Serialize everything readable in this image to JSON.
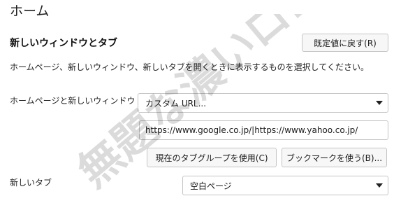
{
  "page": {
    "title": "ホーム"
  },
  "homepage_section": {
    "heading": "新しいウィンドウとタブ",
    "restore_defaults_label": "既定値に戻す(R)",
    "description": "ホームページ、新しいウィンドウ、新しいタブを開くときに表示するものを選択してください。",
    "homepage_label": "ホームページと新しいウィンドウ",
    "homepage_select_value": "カスタム URL...",
    "homepage_url_value": "https://www.google.co.jp/|https://www.yahoo.co.jp/",
    "use_current_pages_label": "現在のタブグループを使用(C)",
    "use_bookmark_label": "ブックマークを使う(B)...",
    "newtab_label": "新しいタブ",
    "newtab_select_value": "空白ページ"
  },
  "watermark": {
    "text": "無題な濃いロゴ"
  },
  "icons": {
    "dropdown": "chevron-down-icon"
  }
}
